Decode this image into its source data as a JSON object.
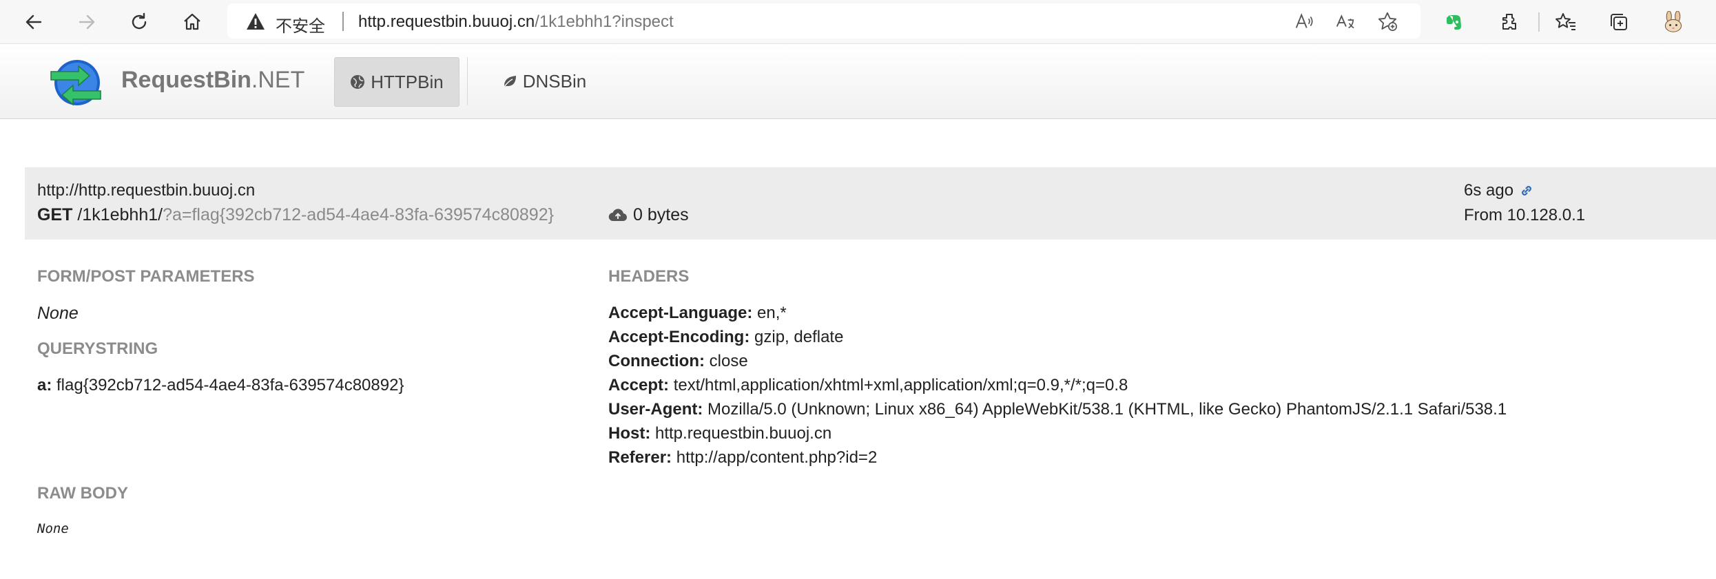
{
  "browser": {
    "address_bar": {
      "security_label": "不安全",
      "url_host": "http.requestbin.buuoj.cn",
      "url_path": "/1k1ebhh1?inspect"
    },
    "icons": [
      "back-icon",
      "forward-icon",
      "refresh-icon",
      "home-icon",
      "warning-icon",
      "read-aloud-icon",
      "translate-icon",
      "add-favorite-icon",
      "evernote-icon",
      "extensions-icon",
      "favorites-icon",
      "collections-icon",
      "profile-avatar-icon"
    ]
  },
  "navbar": {
    "brand_bold": "RequestBin",
    "brand_suffix": ".NET",
    "items": [
      {
        "label": "HTTPBin",
        "active": true,
        "icon": "globe-icon"
      },
      {
        "label": "DNSBin",
        "active": false,
        "icon": "leaf-icon"
      }
    ]
  },
  "request": {
    "host": "http://http.requestbin.buuoj.cn",
    "method": "GET",
    "path": "/1k1ebhh1/",
    "query": "?a=flag{392cb712-ad54-4ae4-83fa-639574c80892}",
    "size": "0 bytes",
    "time": "6s ago",
    "from": "From 10.128.0.1"
  },
  "form_post": {
    "title": "FORM/POST PARAMETERS",
    "value": "None"
  },
  "querystring": {
    "title": "QUERYSTRING",
    "params": [
      {
        "key": "a:",
        "value": "flag{392cb712-ad54-4ae4-83fa-639574c80892}"
      }
    ]
  },
  "headers": {
    "title": "HEADERS",
    "items": [
      {
        "key": "Accept-Language:",
        "value": "en,*"
      },
      {
        "key": "Accept-Encoding:",
        "value": "gzip, deflate"
      },
      {
        "key": "Connection:",
        "value": "close"
      },
      {
        "key": "Accept:",
        "value": "text/html,application/xhtml+xml,application/xml;q=0.9,*/*;q=0.8"
      },
      {
        "key": "User-Agent:",
        "value": "Mozilla/5.0 (Unknown; Linux x86_64) AppleWebKit/538.1 (KHTML, like Gecko) PhantomJS/2.1.1 Safari/538.1"
      },
      {
        "key": "Host:",
        "value": "http.requestbin.buuoj.cn"
      },
      {
        "key": "Referer:",
        "value": "http://app/content.php?id=2"
      }
    ]
  },
  "raw_body": {
    "title": "RAW BODY",
    "value": "None"
  },
  "colors": {
    "section_title": "#8c8c8c",
    "link_blue": "#2a6ebb",
    "evernote_green": "#2dbe60",
    "logo_blue": "#1e63c9",
    "logo_green": "#35c26a"
  }
}
